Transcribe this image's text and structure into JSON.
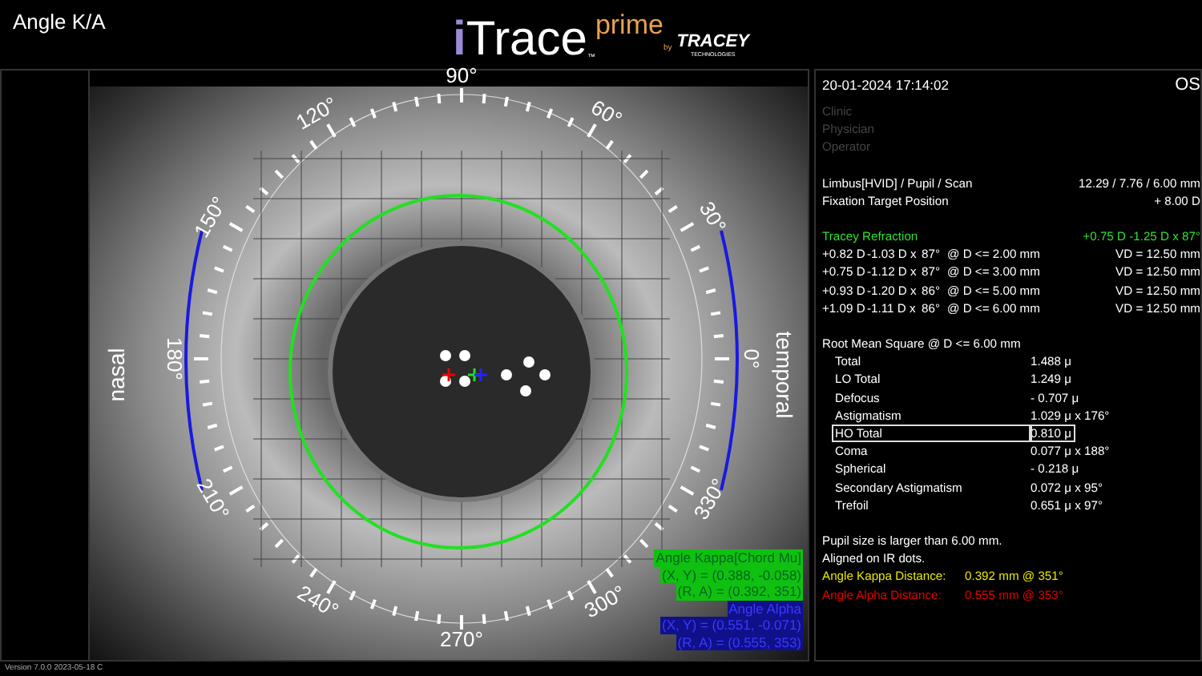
{
  "window": {
    "title": "Angle K/A"
  },
  "logo": {
    "mark": "i",
    "name": "Trace",
    "tm": "™",
    "suffix": "prime",
    "by": "by",
    "maker": "TRACEY",
    "maker_sub": "TECHNOLOGIES"
  },
  "exam_view": {
    "degree_labels": [
      "0°",
      "30°",
      "60°",
      "90°",
      "120°",
      "150°",
      "180°",
      "210°",
      "240°",
      "270°",
      "300°",
      "330°"
    ],
    "side_labels": [
      "nasal",
      "temporal"
    ],
    "kappa_box": {
      "lines": [
        "Angle Kappa[Chord Mu]",
        "(X, Y) = (0.388, -0.058)",
        "(R, A) = (0.392, 351)"
      ]
    },
    "alpha_box": {
      "lines": [
        "Angle Alpha",
        "(X, Y) = (0.551, -0.071)",
        "(R, A) = (0.555, 353)"
      ]
    }
  },
  "info": {
    "datetime": "20-01-2024  17:14:02",
    "eye": "OS",
    "patient_fields": [
      "Clinic",
      "Physician",
      "Operator"
    ],
    "measurements": [
      {
        "label": "Limbus[HVID] / Pupil / Scan",
        "value": "12.29 / 7.76 / 6.00 mm"
      },
      {
        "label": "Fixation Target Position",
        "value": "+ 8.00 D"
      }
    ],
    "refraction": {
      "title": "Tracey Refraction",
      "value": "+0.75 D -1.25 D x 87°",
      "rows": [
        {
          "sphere": "+0.82 D",
          "cyl": "-1.03 D x",
          "axis": "87°",
          "zone": "@ D <= 2.00 mm",
          "vd": "VD = 12.50 mm"
        },
        {
          "sphere": "+0.75 D",
          "cyl": "-1.12 D x",
          "axis": "87°",
          "zone": "@ D <= 3.00 mm",
          "vd": "VD = 12.50 mm"
        },
        {
          "sphere": "+0.93 D",
          "cyl": "-1.20 D x",
          "axis": "86°",
          "zone": "@ D <= 5.00 mm",
          "vd": "VD = 12.50 mm"
        },
        {
          "sphere": "+1.09 D",
          "cyl": "-1.11 D x",
          "axis": "86°",
          "zone": "@ D <= 6.00 mm",
          "vd": "VD = 12.50 mm"
        }
      ]
    },
    "rms": {
      "title": "Root Mean Square @ D <= 6.00 mm",
      "rows": [
        {
          "label": "Total",
          "value": "1.488 μ",
          "selected": false
        },
        {
          "label": "LO Total",
          "value": "1.249 μ",
          "selected": false
        },
        {
          "label": "Defocus",
          "value": "- 0.707 μ",
          "selected": false
        },
        {
          "label": "Astigmatism",
          "value": "1.029 μ x 176°",
          "selected": false
        },
        {
          "label": "HO Total",
          "value": "0.810 μ",
          "selected": true
        },
        {
          "label": "Coma",
          "value": "0.077 μ x 188°",
          "selected": false
        },
        {
          "label": "Spherical",
          "value": "- 0.218 μ",
          "selected": false
        },
        {
          "label": "Secondary Astigmatism",
          "value": "0.072 μ x  95°",
          "selected": false
        },
        {
          "label": "Trefoil",
          "value": "0.651 μ x  97°",
          "selected": false
        }
      ]
    },
    "notes": [
      "Pupil size is larger than 6.00 mm.",
      "Aligned on IR dots."
    ],
    "distances": [
      {
        "label": "Angle Kappa Distance:",
        "value": "0.392 mm @ 351°",
        "color": "#e6e600"
      },
      {
        "label": "Angle Alpha Distance:",
        "value": "0.555 mm @ 353°",
        "color": "#e60000"
      }
    ]
  },
  "version": "Version 7.0.0 2023-05-18 C"
}
